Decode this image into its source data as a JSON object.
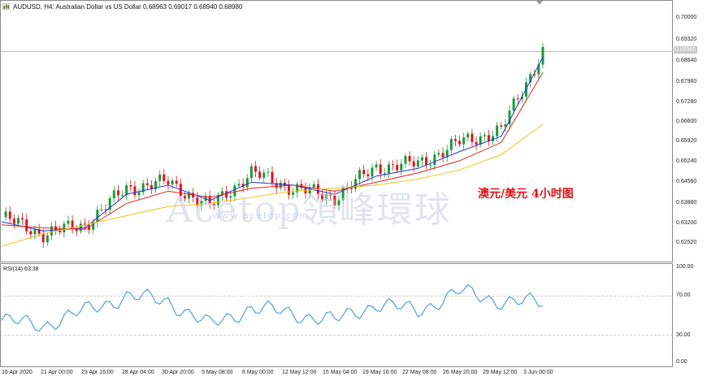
{
  "header": {
    "title": "AUDUSD, H4:  Australian Dollar vs US Dollar  0.68963 0.69017 0.68940 0.68980",
    "icon": "chart-window-icon"
  },
  "price_axis": [
    "0.70000",
    "0.69320",
    "0.68640",
    "0.67960",
    "0.67280",
    "0.66600",
    "0.65920",
    "0.65240",
    "0.64560",
    "0.63880",
    "0.63200",
    "0.62520"
  ],
  "current_price": "0.68980",
  "rsi": {
    "title": "RSI(14) 63.38",
    "axis": [
      "100.00",
      "70.00",
      "30.00",
      "0.00"
    ]
  },
  "time_axis": [
    "16 Apr 2020",
    "21 Apr 00:00",
    "23 Apr 16:00",
    "28 Apr 04:00",
    "30 Apr 20:00",
    "5 May 08:00",
    "8 May 00:00",
    "12 May 12:00",
    "15 May 04:00",
    "19 May 16:00",
    "22 May 08:00",
    "26 May 20:00",
    "29 May 12:00",
    "3 Jun 00:00"
  ],
  "overlay": {
    "caption": "澳元/美元 4小时图",
    "watermark": "Acetop領峰環球",
    "watermark_url": "www.acetop.com"
  },
  "colors": {
    "bull": "#1a9a3a",
    "bear": "#e0141e",
    "ma_fast": "#2433d6",
    "ma_mid": "#e0241e",
    "ma_slow": "#f2c21a",
    "rsi_line": "#2e8ee6"
  },
  "chart_data": {
    "type": "line",
    "symbol": "AUDUSD",
    "timeframe": "H4",
    "ylim": [
      0.622,
      0.703
    ],
    "x": [
      "16 Apr 2020",
      "21 Apr 00:00",
      "23 Apr 16:00",
      "28 Apr 04:00",
      "30 Apr 20:00",
      "5 May 08:00",
      "8 May 00:00",
      "12 May 12:00",
      "15 May 04:00",
      "19 May 16:00",
      "22 May 08:00",
      "26 May 20:00",
      "29 May 12:00",
      "3 Jun 00:00"
    ],
    "series": [
      {
        "values": [
          0.6355,
          0.63,
          0.633,
          0.645,
          0.647,
          0.639,
          0.65,
          0.645,
          0.642,
          0.652,
          0.653,
          0.66,
          0.664,
          0.69
        ]
      },
      {
        "values": [
          0.634,
          0.631,
          0.632,
          0.643,
          0.646,
          0.641,
          0.647,
          0.646,
          0.643,
          0.649,
          0.6515,
          0.657,
          0.662,
          0.688
        ]
      },
      {
        "values": [
          0.633,
          0.632,
          0.6315,
          0.64,
          0.644,
          0.642,
          0.645,
          0.646,
          0.644,
          0.647,
          0.65,
          0.654,
          0.66,
          0.683
        ]
      },
      {
        "values": [
          0.626,
          0.63,
          0.633,
          0.636,
          0.639,
          0.64,
          0.642,
          0.644,
          0.645,
          0.646,
          0.648,
          0.651,
          0.656,
          0.666
        ]
      }
    ],
    "rsi_values": [
      45,
      40,
      55,
      70,
      65,
      40,
      58,
      52,
      45,
      62,
      55,
      75,
      65,
      63
    ],
    "rsi_ylim": [
      0,
      100
    ],
    "rsi_levels": [
      70,
      30
    ]
  }
}
